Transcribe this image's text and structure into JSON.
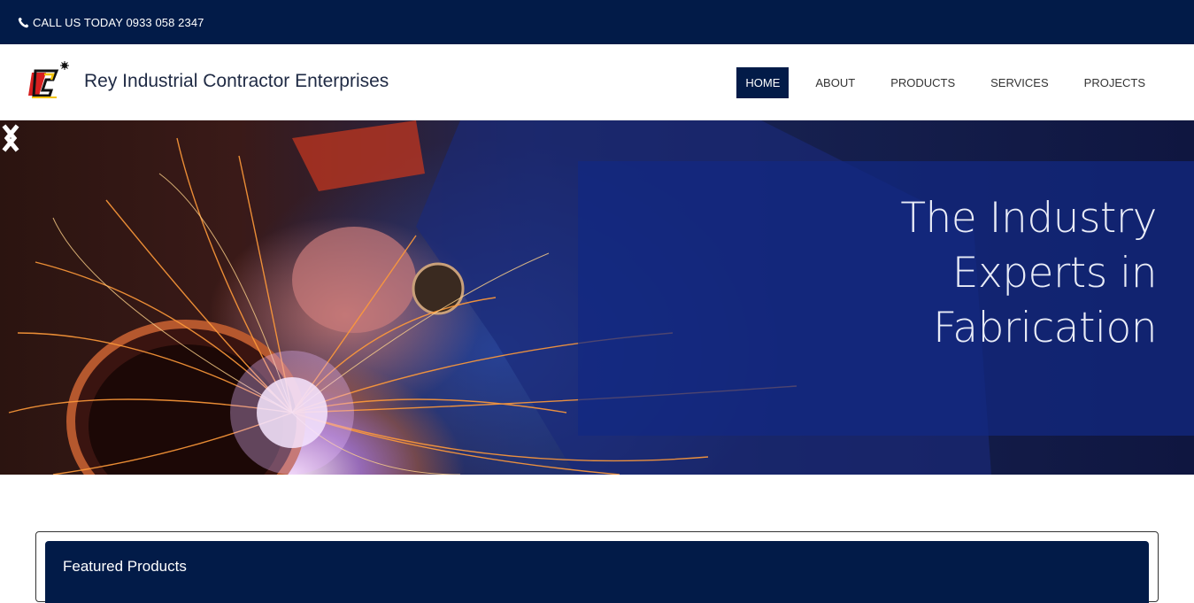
{
  "topbar": {
    "phone_text": "CALL US TODAY 0933 058 2347",
    "icon": "phone-icon"
  },
  "header": {
    "brand_name": "Rey Industrial Contractor Enterprises",
    "logo_icon": "rice-logo"
  },
  "nav": {
    "items": [
      {
        "label": "HOME",
        "active": true
      },
      {
        "label": "ABOUT",
        "active": false
      },
      {
        "label": "PRODUCTS",
        "active": false
      },
      {
        "label": "SERVICES",
        "active": false
      },
      {
        "label": "PROJECTS",
        "active": false
      }
    ]
  },
  "hero": {
    "line1": "The Industry",
    "line2": "Experts in",
    "line3": "Fabrication",
    "prev_icon": "chevron-left-icon",
    "next_icon": "chevron-right-icon"
  },
  "featured": {
    "title": "Featured Products"
  },
  "colors": {
    "brand_navy": "#021b48",
    "panel_blue": "#12288280",
    "white": "#ffffff"
  }
}
